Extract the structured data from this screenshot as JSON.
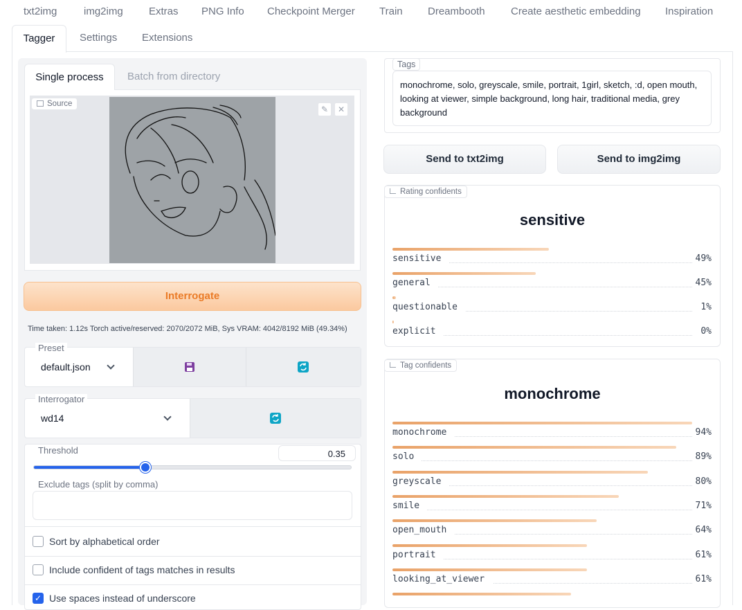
{
  "top_tabs": [
    "txt2img",
    "img2img",
    "Extras",
    "PNG Info",
    "Checkpoint Merger",
    "Train",
    "Dreambooth",
    "Create aesthetic embedding",
    "Inspiration"
  ],
  "second_tabs": {
    "active": "Tagger",
    "others": [
      "Settings",
      "Extensions"
    ]
  },
  "subtabs": {
    "active": "Single process",
    "other": "Batch from directory"
  },
  "source": {
    "label": "Source"
  },
  "interrogate_label": "Interrogate",
  "time_taken": "Time taken: 1.12s  Torch active/reserved: 2070/2072 MiB, Sys VRAM: 4042/8192 MiB (49.34%)",
  "preset": {
    "label": "Preset",
    "value": "default.json"
  },
  "interrogator": {
    "label": "Interrogator",
    "value": "wd14"
  },
  "threshold": {
    "label": "Threshold",
    "value": "0.35",
    "fraction": 0.35
  },
  "exclude": {
    "label": "Exclude tags (split by comma)",
    "value": ""
  },
  "checkboxes": [
    {
      "label": "Sort by alphabetical order",
      "checked": false
    },
    {
      "label": "Include confident of tags matches in results",
      "checked": false
    },
    {
      "label": "Use spaces instead of underscore",
      "checked": true
    }
  ],
  "tags": {
    "label": "Tags",
    "value": "monochrome, solo, greyscale, smile, portrait, 1girl, sketch, :d, open mouth, looking at viewer, simple background, long hair, traditional media, grey background"
  },
  "send_txt2img": "Send to txt2img",
  "send_img2img": "Send to img2img",
  "rating": {
    "label": "Rating confidents",
    "top": "sensitive",
    "items": [
      {
        "name": "sensitive",
        "pct": "49%",
        "value": 0.49
      },
      {
        "name": "general",
        "pct": "45%",
        "value": 0.45
      },
      {
        "name": "questionable",
        "pct": "1%",
        "value": 0.01
      },
      {
        "name": "explicit",
        "pct": "0%",
        "value": 0.0
      }
    ]
  },
  "tag_conf": {
    "label": "Tag confidents",
    "top": "monochrome",
    "items": [
      {
        "name": "monochrome",
        "pct": "94%",
        "value": 0.94
      },
      {
        "name": "solo",
        "pct": "89%",
        "value": 0.89
      },
      {
        "name": "greyscale",
        "pct": "80%",
        "value": 0.8
      },
      {
        "name": "smile",
        "pct": "71%",
        "value": 0.71
      },
      {
        "name": "open_mouth",
        "pct": "64%",
        "value": 0.64
      },
      {
        "name": "portrait",
        "pct": "61%",
        "value": 0.61
      },
      {
        "name": "looking_at_viewer",
        "pct": "61%",
        "value": 0.61
      },
      {
        "name": "",
        "pct": "",
        "value": 0.56
      }
    ]
  },
  "colors": {
    "accent": "#ea7b26",
    "bar": "#e9a268",
    "checkbox": "#2563eb",
    "refresh": "#0ea5c6",
    "save": "#7e3fa0"
  }
}
